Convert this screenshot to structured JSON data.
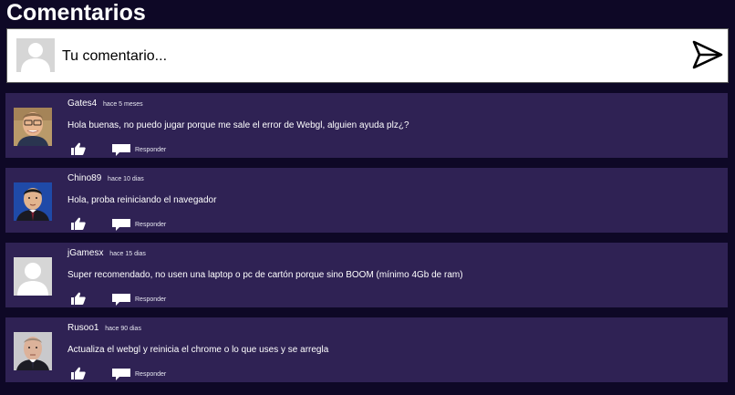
{
  "section_title": "Comentarios",
  "composer": {
    "placeholder": "Tu comentario...",
    "avatar_icon": "default-user-avatar",
    "send_icon": "paper-plane-icon"
  },
  "colors": {
    "background": "#0e0826",
    "card": "#2f2254",
    "composer_bg": "#ffffff"
  },
  "comments": [
    {
      "author": "Gates4",
      "time": "hace 5 meses",
      "text": "Hola buenas, no puedo jugar porque me sale el error de Webgl, alguien ayuda plz¿?",
      "reply_label": "Responder",
      "avatar": "photo"
    },
    {
      "author": "Chino89",
      "time": "hace 10 dias",
      "text": "Hola, proba reiniciando el navegador",
      "reply_label": "Responder",
      "avatar": "photo"
    },
    {
      "author": "jGamesx",
      "time": "hace 15 dias",
      "text": "Super recomendado, no usen una laptop o pc de cartón porque sino BOOM (mínimo 4Gb de ram)",
      "reply_label": "Responder",
      "avatar": "default"
    },
    {
      "author": "Rusoo1",
      "time": "hace 90 dias",
      "text": "Actualiza el webgl y reinicia el chrome o lo que uses y se arregla",
      "reply_label": "Responder",
      "avatar": "photo"
    }
  ]
}
